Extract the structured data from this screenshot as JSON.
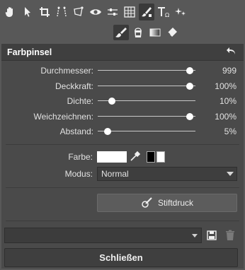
{
  "toolbar": {
    "tools_row1": [
      {
        "icon": "hand-icon"
      },
      {
        "icon": "pointer-icon"
      },
      {
        "icon": "crop-icon"
      },
      {
        "icon": "perspective-icon"
      },
      {
        "icon": "transform-icon"
      },
      {
        "icon": "eye-icon"
      },
      {
        "icon": "levels-icon"
      },
      {
        "icon": "grid-icon"
      },
      {
        "icon": "brush-bucket-icon",
        "active": true
      },
      {
        "icon": "text-icon"
      },
      {
        "icon": "sparkle-icon"
      }
    ],
    "tools_row2": [
      {
        "icon": "brush-icon",
        "active": true
      },
      {
        "icon": "bucket-icon"
      },
      {
        "icon": "gradient-icon"
      },
      {
        "icon": "eraser-icon"
      }
    ]
  },
  "panel": {
    "title": "Farbpinsel",
    "undo_icon": "undo-arrow-icon",
    "sliders": [
      {
        "label": "Durchmesser:",
        "value": "999",
        "fraction": 1.0
      },
      {
        "label": "Deckkraft:",
        "value": "100%",
        "fraction": 1.0
      },
      {
        "label": "Dichte:",
        "value": "10%",
        "fraction": 0.1
      },
      {
        "label": "Weichzeichnen:",
        "value": "100%",
        "fraction": 1.0
      },
      {
        "label": "Abstand:",
        "value": "5%",
        "fraction": 0.05
      }
    ],
    "color_label": "Farbe:",
    "color_value": "#ffffff",
    "mode_label": "Modus:",
    "mode_value": "Normal",
    "stylus_button": "Stiftdruck",
    "close_button": "Schließen"
  },
  "colors": {
    "background": "#585858",
    "panel": "#4a4a4a",
    "header": "#3f3f3f",
    "accent_white": "#ffffff"
  }
}
